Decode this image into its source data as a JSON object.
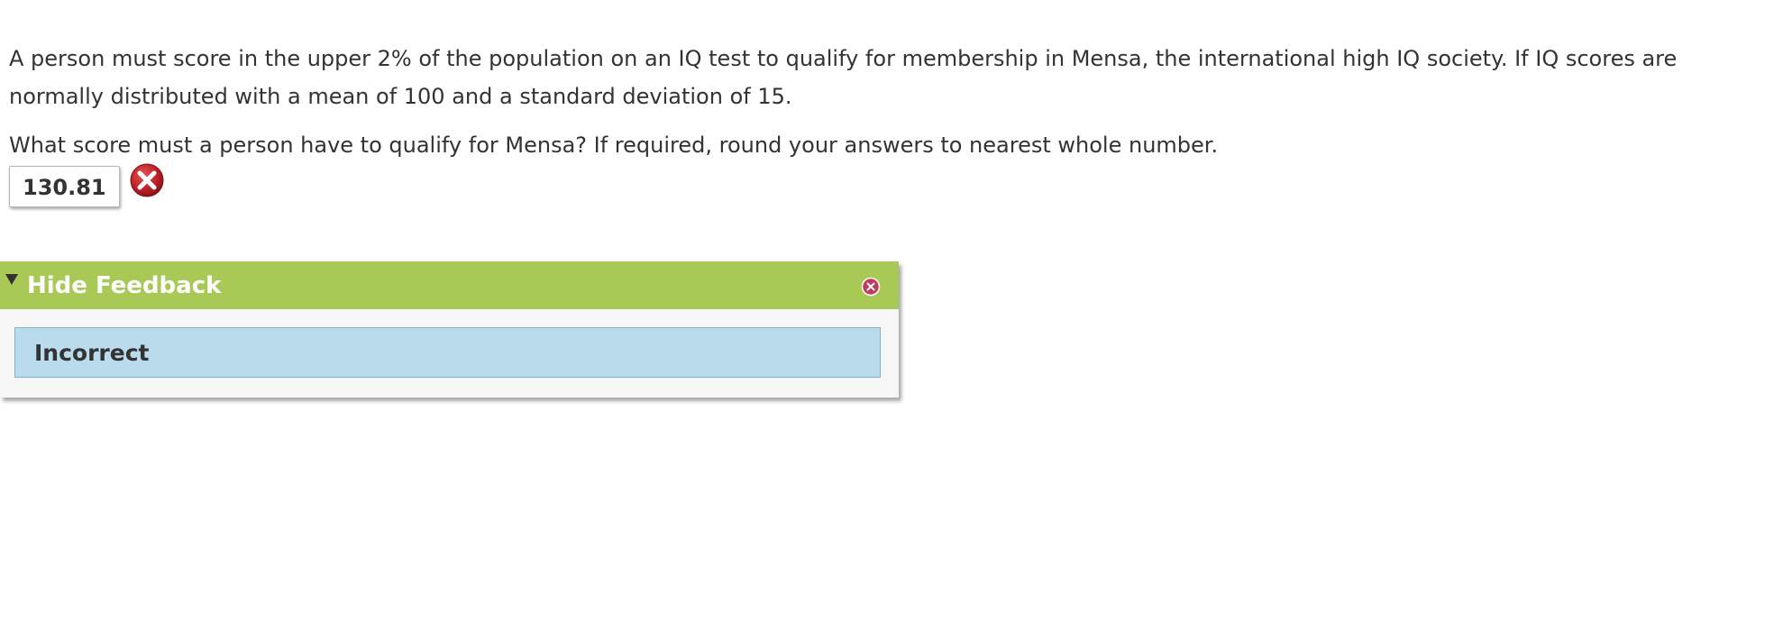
{
  "question": {
    "text": "A person must score in the upper 2% of the population on an IQ test to qualify for membership in Mensa, the international high IQ society. If IQ scores are normally distributed with a mean of 100 and a standard deviation of 15.",
    "prompt": "What score must a person have to qualify for Mensa? If required, round your answers to nearest whole number."
  },
  "answer": {
    "value": "130.81",
    "status_icon": "incorrect-x-icon"
  },
  "feedback": {
    "toggle_label": "Hide Feedback",
    "result": "Incorrect"
  },
  "colors": {
    "header_bg": "#a9c957",
    "result_bg": "#b9dbeb",
    "wrong_icon": "#c0272d"
  }
}
